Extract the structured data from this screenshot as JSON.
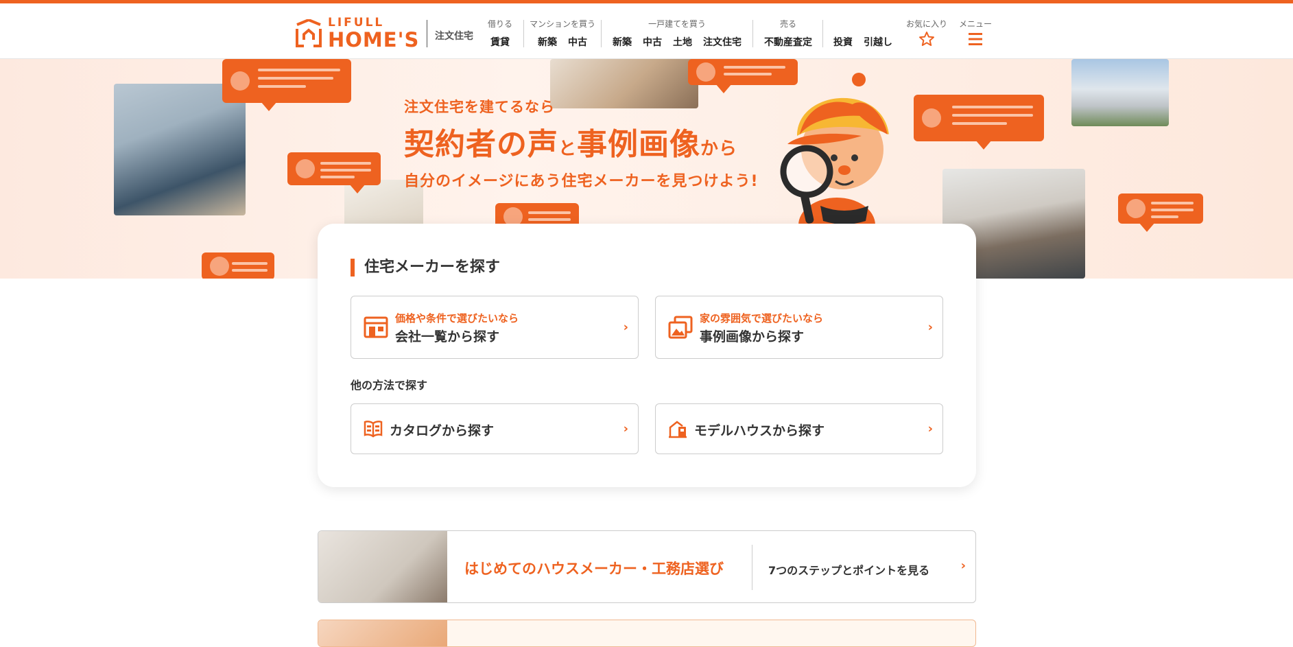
{
  "header": {
    "logo_top": "LIFULL",
    "logo_bottom": "HOME'S",
    "logo_sub": "注文住宅",
    "nav": [
      {
        "caption": "借りる",
        "links": [
          "賃貸"
        ]
      },
      {
        "caption": "マンションを買う",
        "links": [
          "新築",
          "中古"
        ]
      },
      {
        "caption": "一戸建てを買う",
        "links": [
          "新築",
          "中古",
          "土地",
          "注文住宅"
        ]
      },
      {
        "caption": "売る",
        "links": [
          "不動産査定"
        ]
      },
      {
        "caption": "",
        "links": [
          "投資",
          "引越し"
        ]
      }
    ],
    "favorites_label": "お気に入り",
    "menu_label": "メニュー",
    "accent": "#ee6220"
  },
  "hero": {
    "line1": "注文住宅を建てるなら",
    "line2a": "契約者の声",
    "line2b": "と",
    "line2c": "事例画像",
    "line2d": "から",
    "line3": "自分のイメージにあう住宅メーカーを見つけよう!"
  },
  "search": {
    "title": "住宅メーカーを探す",
    "primary": [
      {
        "sub": "価格や条件で選びたいなら",
        "main": "会社一覧から探す",
        "icon": "store-icon"
      },
      {
        "sub": "家の雰囲気で選びたいなら",
        "main": "事例画像から探す",
        "icon": "photos-icon"
      }
    ],
    "other_label": "他の方法で探す",
    "secondary": [
      {
        "main": "カタログから探す",
        "icon": "catalog-icon"
      },
      {
        "main": "モデルハウスから探す",
        "icon": "model-house-icon"
      }
    ]
  },
  "guide_banner": {
    "title": "はじめてのハウスメーカー・工務店選び",
    "link": "7つのステップとポイントを見る"
  }
}
